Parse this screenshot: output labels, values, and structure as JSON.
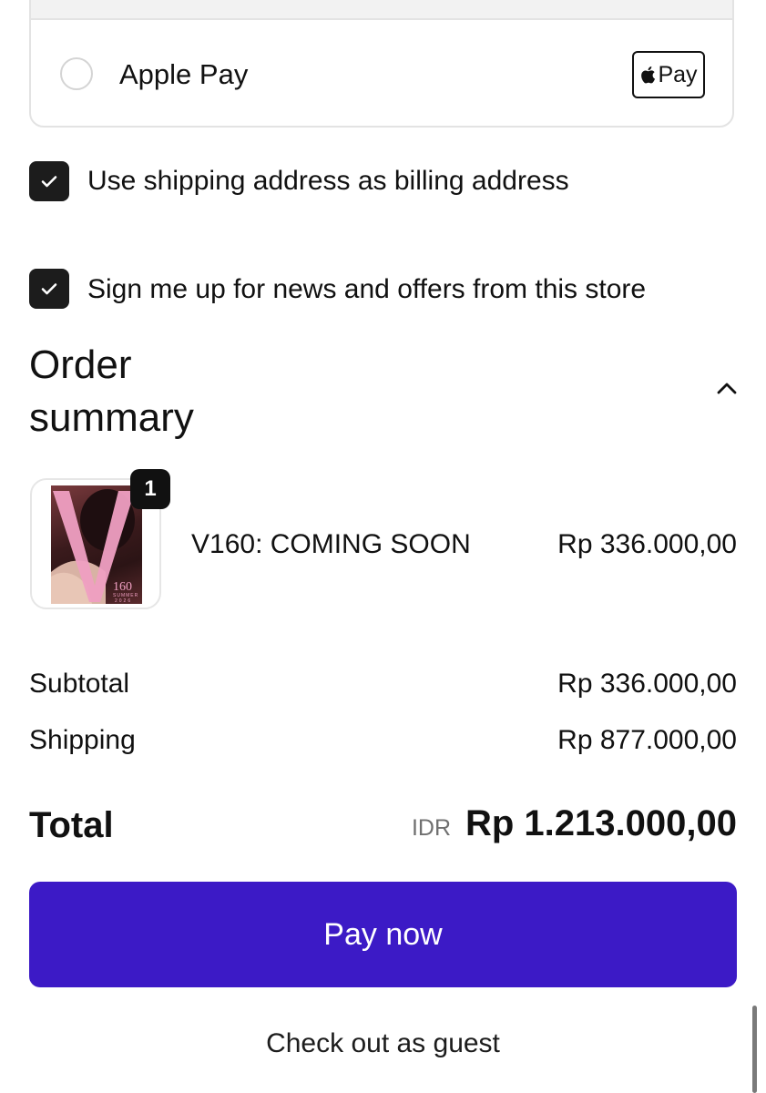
{
  "payment": {
    "option_label": "Apple Pay",
    "badge_text": "Pay",
    "selected": false
  },
  "checkboxes": [
    {
      "label": "Use shipping address as billing address",
      "checked": true
    },
    {
      "label": "Sign me up for news and offers from this store",
      "checked": true
    }
  ],
  "order_summary": {
    "title": "Order summary",
    "expanded": true,
    "items": [
      {
        "name": "V160: COMING SOON",
        "price": "Rp 336.000,00",
        "quantity": "1",
        "cover": {
          "big_letter": "V",
          "issue": "160",
          "season": "SUMMER",
          "year": "2026"
        }
      }
    ],
    "subtotal": {
      "label": "Subtotal",
      "value": "Rp 336.000,00"
    },
    "shipping": {
      "label": "Shipping",
      "value": "Rp 877.000,00"
    },
    "total": {
      "label": "Total",
      "currency": "IDR",
      "value": "Rp 1.213.000,00"
    }
  },
  "actions": {
    "pay_label": "Pay now",
    "guest_label": "Check out as guest"
  },
  "colors": {
    "pay_button": "#3c1ac6",
    "checkbox": "#1c1c1c"
  }
}
